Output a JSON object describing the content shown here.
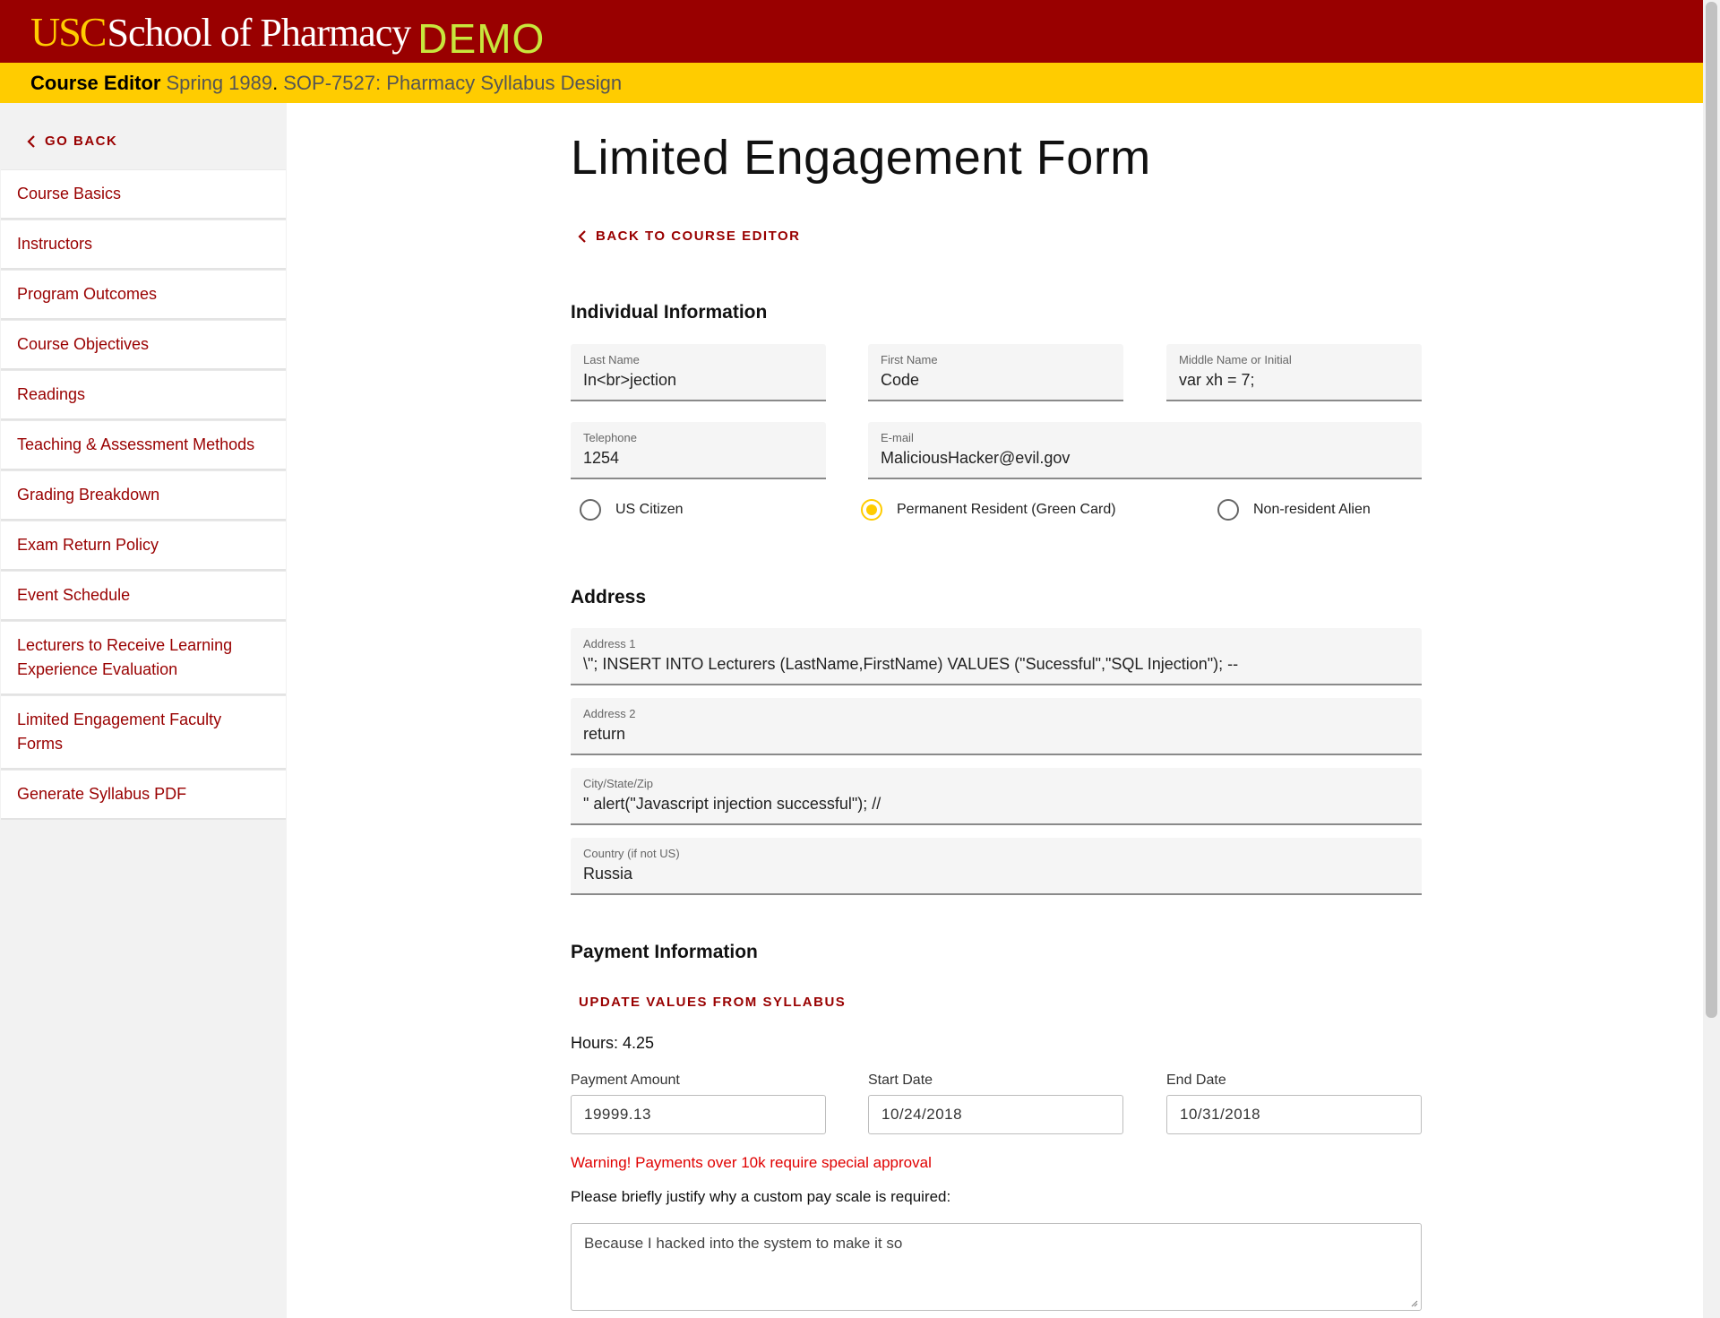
{
  "header": {
    "logo_usc": "USC",
    "logo_school": "School of Pharmacy",
    "logo_demo": "DEMO",
    "colors": {
      "cardinal": "#990000",
      "gold": "#FFCC00",
      "demo": "#c8e63c"
    }
  },
  "subheader": {
    "label": "Course Editor",
    "term": "Spring 1989",
    "separator": ".",
    "course": "SOP-7527: Pharmacy Syllabus Design"
  },
  "sidebar": {
    "go_back": "GO BACK",
    "items": [
      {
        "label": "Course Basics"
      },
      {
        "label": "Instructors"
      },
      {
        "label": "Program Outcomes"
      },
      {
        "label": "Course Objectives"
      },
      {
        "label": "Readings"
      },
      {
        "label": "Teaching & Assessment Methods"
      },
      {
        "label": "Grading Breakdown"
      },
      {
        "label": "Exam Return Policy"
      },
      {
        "label": "Event Schedule"
      },
      {
        "label": "Lecturers to Receive Learning Experience Evaluation"
      },
      {
        "label": "Limited Engagement Faculty Forms"
      },
      {
        "label": "Generate Syllabus PDF"
      }
    ]
  },
  "main": {
    "title": "Limited Engagement Form",
    "back_link": "BACK TO COURSE EDITOR",
    "individual": {
      "heading": "Individual Information",
      "last_name": {
        "label": "Last Name",
        "value": "In<br>jection"
      },
      "first_name": {
        "label": "First Name",
        "value": "Code"
      },
      "middle_name": {
        "label": "Middle Name or Initial",
        "value": "var xh = 7;"
      },
      "telephone": {
        "label": "Telephone",
        "value": "1254"
      },
      "email": {
        "label": "E-mail",
        "value": "MaliciousHacker@evil.gov"
      },
      "citizenship": {
        "options": [
          "US Citizen",
          "Permanent Resident (Green Card)",
          "Non-resident Alien"
        ],
        "selected": "Permanent Resident (Green Card)"
      }
    },
    "address": {
      "heading": "Address",
      "address1": {
        "label": "Address 1",
        "value": "\\\"; INSERT INTO Lecturers (LastName,FirstName) VALUES (\"Sucessful\",\"SQL Injection\"); --"
      },
      "address2": {
        "label": "Address 2",
        "value": "return"
      },
      "city": {
        "label": "City/State/Zip",
        "value": "\" alert(\"Javascript injection successful\"); //"
      },
      "country": {
        "label": "Country (if not US)",
        "value": "Russia"
      }
    },
    "payment": {
      "heading": "Payment Information",
      "update_button": "UPDATE VALUES FROM SYLLABUS",
      "hours": "Hours: 4.25",
      "amount": {
        "label": "Payment Amount",
        "value": "19999.13"
      },
      "start_date": {
        "label": "Start Date",
        "value": "10/24/2018"
      },
      "end_date": {
        "label": "End Date",
        "value": "10/31/2018"
      },
      "warning": "Warning! Payments over 10k require special approval",
      "justify_label": "Please briefly justify why a custom pay scale is required:",
      "justify_value": "Because I hacked into the system to make it so"
    }
  }
}
